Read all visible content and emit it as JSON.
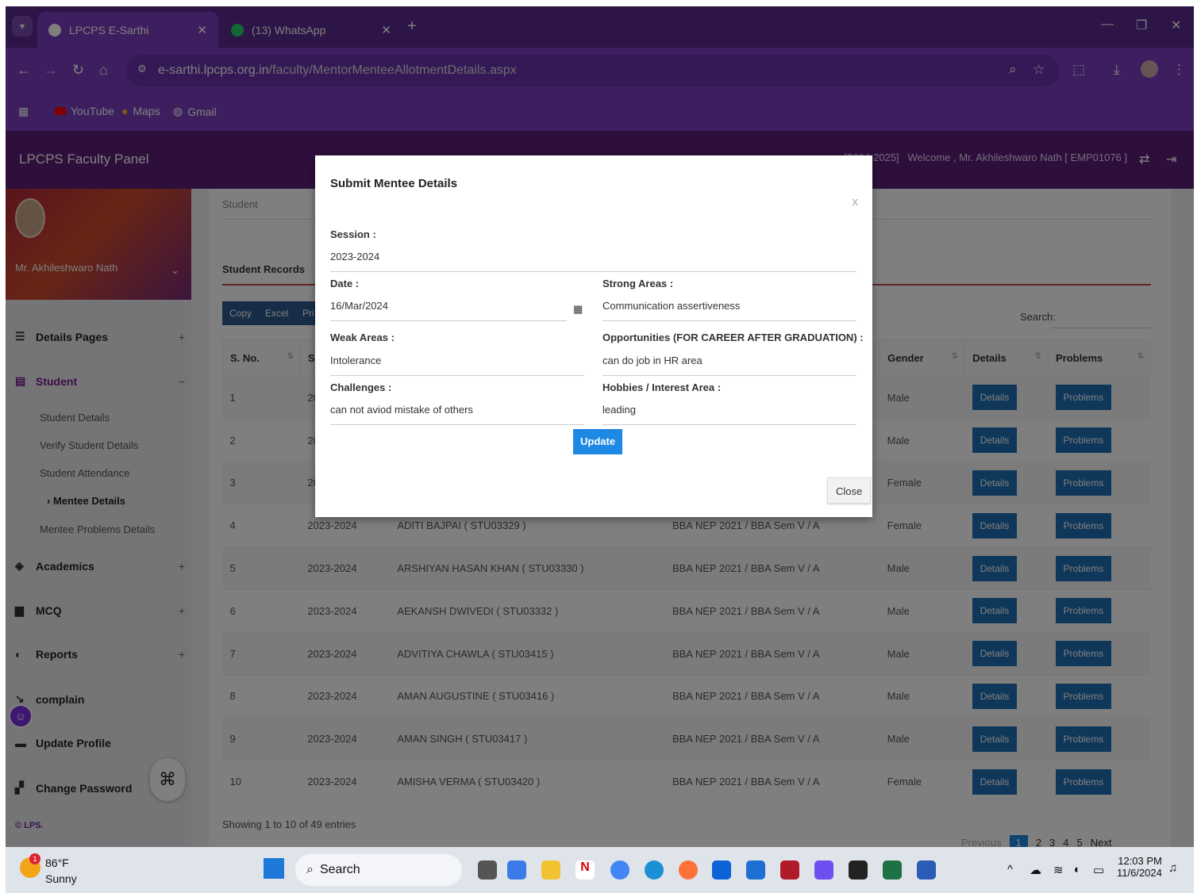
{
  "browser": {
    "tabs": [
      {
        "title": "LPCPS E-Sarthi",
        "active": true
      },
      {
        "title": "(13) WhatsApp",
        "active": false
      }
    ],
    "url_host": "e-sarthi.lpcps.org.in",
    "url_path": "/faculty/MentorMenteeAllotmentDetails.aspx",
    "bookmarks": [
      "YouTube",
      "Maps",
      "Gmail"
    ]
  },
  "app": {
    "title": "LPCPS Faculty Panel",
    "session_info": "n [2024-2025]",
    "welcome": "Welcome , Mr. Akhileshwaro Nath [ EMP01076 ]"
  },
  "sidebar": {
    "user_name": "Mr. Akhileshwaro Nath",
    "menu": [
      {
        "label": "Details Pages",
        "sign": "+"
      },
      {
        "label": "Student",
        "sign": "−"
      },
      {
        "label": "Academics",
        "sign": "+"
      },
      {
        "label": "MCQ",
        "sign": "+"
      },
      {
        "label": "Reports",
        "sign": "+"
      },
      {
        "label": "complain",
        "sign": ""
      },
      {
        "label": "Update Profile",
        "sign": ""
      },
      {
        "label": "Change Password",
        "sign": ""
      }
    ],
    "submenu": [
      "Student Details",
      "Verify Student Details",
      "Student Attendance",
      "Mentee Details",
      "Mentee Problems Details"
    ],
    "copyright": "© LPS."
  },
  "main": {
    "breadcrumb": "Student",
    "section_title": "Student Records",
    "export_buttons": [
      "Copy",
      "Excel",
      "Pri"
    ],
    "search_label": "Search:",
    "columns": [
      "S. No.",
      "Se",
      "",
      "",
      "Gender",
      "Details",
      "Problems"
    ],
    "rows": [
      {
        "sno": "1",
        "session": "20",
        "name": "",
        "class": "",
        "gender": "Male"
      },
      {
        "sno": "2",
        "session": "20",
        "name": "",
        "class": "",
        "gender": "Male"
      },
      {
        "sno": "3",
        "session": "20",
        "name": "",
        "class": "",
        "gender": "Female"
      },
      {
        "sno": "4",
        "session": "2023-2024",
        "name": "ADITI BAJPAI ( STU03329 )",
        "class": "BBA NEP 2021 / BBA Sem V / A",
        "gender": "Female"
      },
      {
        "sno": "5",
        "session": "2023-2024",
        "name": "ARSHIYAN HASAN KHAN ( STU03330 )",
        "class": "BBA NEP 2021 / BBA Sem V / A",
        "gender": "Male"
      },
      {
        "sno": "6",
        "session": "2023-2024",
        "name": "AEKANSH DWIVEDI ( STU03332 )",
        "class": "BBA NEP 2021 / BBA Sem V / A",
        "gender": "Male"
      },
      {
        "sno": "7",
        "session": "2023-2024",
        "name": "ADVITIYA CHAWLA ( STU03415 )",
        "class": "BBA NEP 2021 / BBA Sem V / A",
        "gender": "Male"
      },
      {
        "sno": "8",
        "session": "2023-2024",
        "name": "AMAN AUGUSTINE ( STU03416 )",
        "class": "BBA NEP 2021 / BBA Sem V / A",
        "gender": "Male"
      },
      {
        "sno": "9",
        "session": "2023-2024",
        "name": "AMAN SINGH ( STU03417 )",
        "class": "BBA NEP 2021 / BBA Sem V / A",
        "gender": "Male"
      },
      {
        "sno": "10",
        "session": "2023-2024",
        "name": "AMISHA VERMA ( STU03420 )",
        "class": "BBA NEP 2021 / BBA Sem V / A",
        "gender": "Female"
      }
    ],
    "details_label": "Details",
    "problems_label": "Problems",
    "showing": "Showing 1 to 10 of 49 entries",
    "pager": {
      "prev": "Previous",
      "pages": [
        "1",
        "2",
        "3",
        "4",
        "5"
      ],
      "next": "Next"
    }
  },
  "modal": {
    "title": "Submit Mentee Details",
    "close_x": "x",
    "session_label": "Session :",
    "session_value": "2023-2024",
    "date_label": "Date :",
    "date_value": "16/Mar/2024",
    "strong_label": "Strong Areas :",
    "strong_value": "Communication assertiveness",
    "weak_label": "Weak Areas :",
    "weak_value": "Intolerance",
    "opp_label": "Opportunities (FOR CAREER AFTER GRADUATION) :",
    "opp_value": "can do job in HR area",
    "challenges_label": "Challenges :",
    "challenges_value": "can not aviod mistake of others",
    "hobbies_label": "Hobbies / Interest Area :",
    "hobbies_value": "leading",
    "update_label": "Update",
    "close_label": "Close"
  },
  "taskbar": {
    "weather_badge": "1",
    "temp": "86°F",
    "condition": "Sunny",
    "search": "Search",
    "time": "12:03 PM",
    "date": "11/6/2024"
  }
}
